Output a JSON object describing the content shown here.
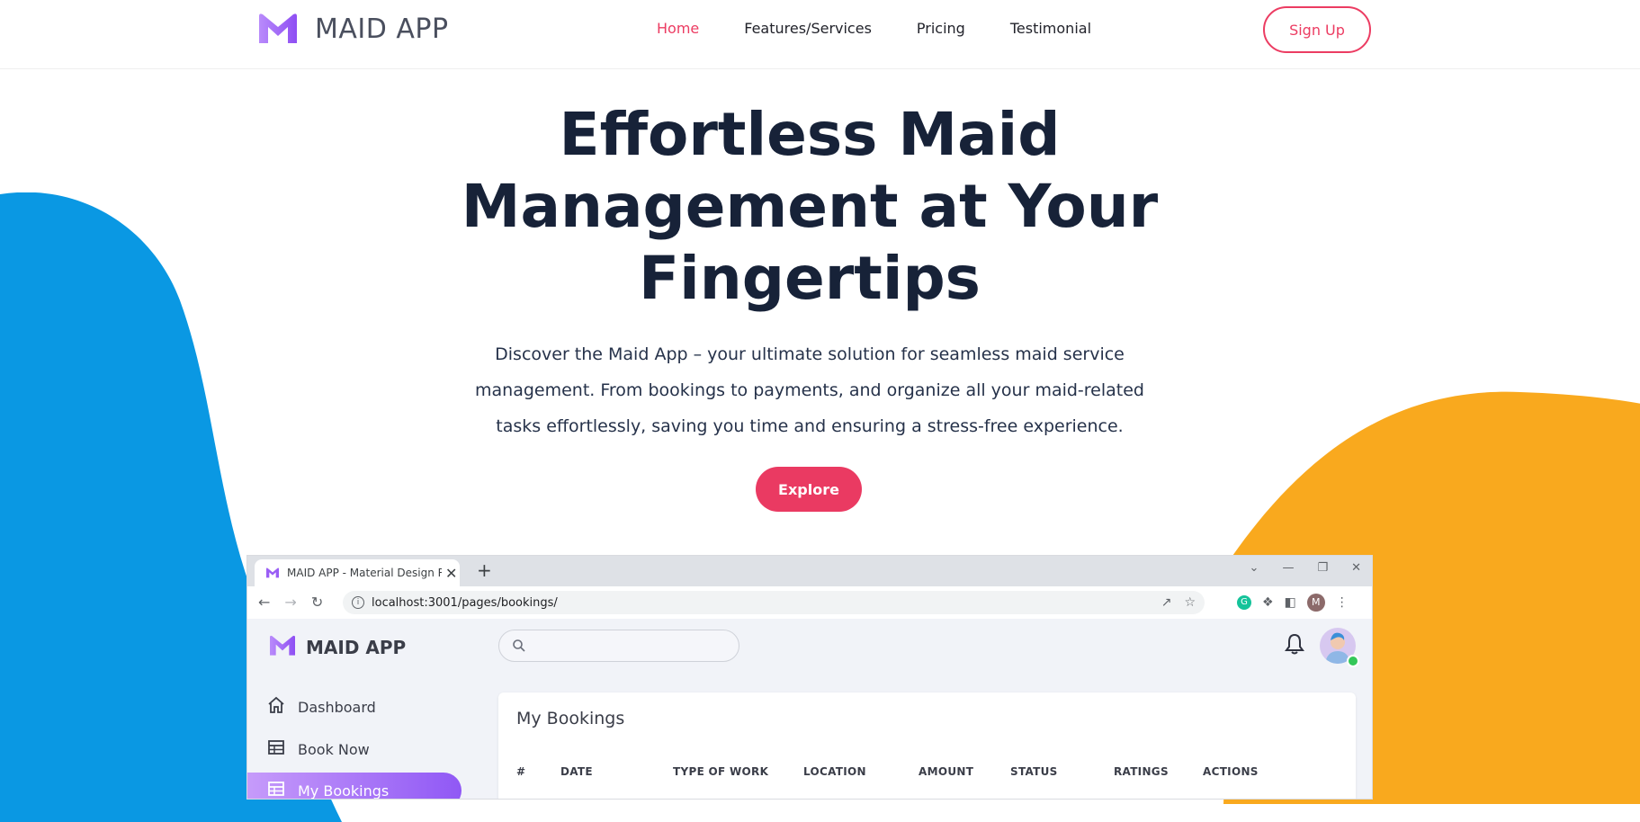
{
  "colors": {
    "accent": "#ec3c62",
    "blue_blob": "#0a98e3",
    "orange_blob": "#f9a91e",
    "title": "#172238",
    "sidebar_active": "#9058f5"
  },
  "brand": {
    "name": "MAID APP"
  },
  "nav": {
    "items": [
      {
        "label": "Home",
        "active": true
      },
      {
        "label": "Features/Services",
        "active": false
      },
      {
        "label": "Pricing",
        "active": false
      },
      {
        "label": "Testimonial",
        "active": false
      }
    ],
    "signup_label": "Sign Up"
  },
  "hero": {
    "title": "Effortless Maid Management at Your Fingertips",
    "description": "Discover the Maid App – your ultimate solution for seamless maid service management. From bookings to payments, and organize all your maid-related tasks effortlessly, saving you time and ensuring a stress-free experience.",
    "cta_label": "Explore"
  },
  "browser": {
    "tab_title": "MAID APP - Material Design Rea",
    "tab_close": "✕",
    "new_tab": "+",
    "url": "localhost:3001/pages/bookings/",
    "profile_initial": "M",
    "grammarly_initial": "G"
  },
  "app": {
    "brand": "MAID APP",
    "search_placeholder": "",
    "sidebar": [
      {
        "label": "Dashboard",
        "icon": "home-icon"
      },
      {
        "label": "Book Now",
        "icon": "table-icon"
      },
      {
        "label": "My Bookings",
        "icon": "table-icon",
        "active": true
      }
    ],
    "card_title": "My Bookings",
    "table_headers": [
      "#",
      "DATE",
      "TYPE OF WORK",
      "LOCATION",
      "AMOUNT",
      "STATUS",
      "RATINGS",
      "ACTIONS"
    ]
  }
}
